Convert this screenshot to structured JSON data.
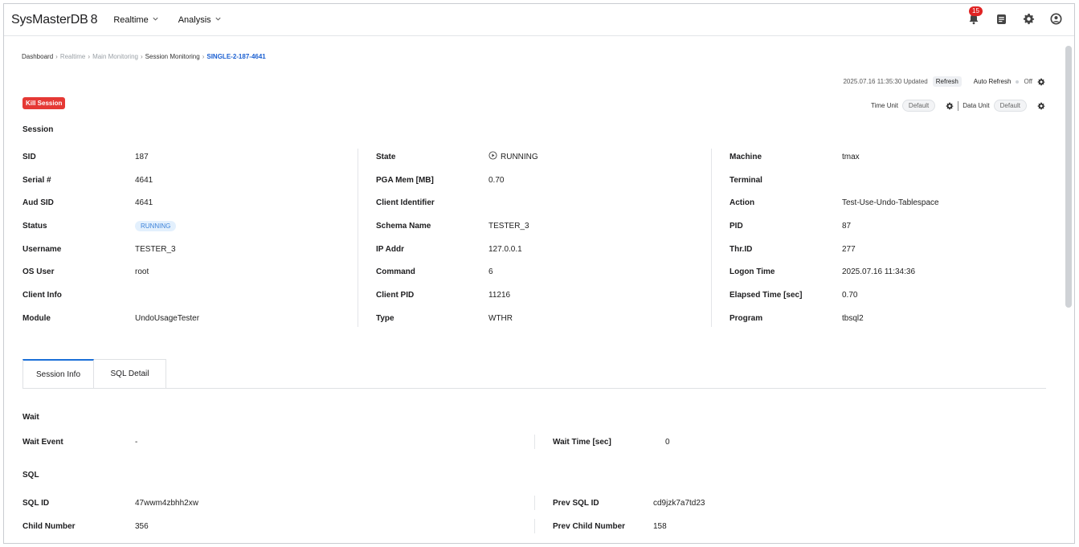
{
  "app": {
    "brand": "SysMasterDB",
    "version": "8"
  },
  "nav": {
    "menu": [
      {
        "label": "Realtime"
      },
      {
        "label": "Analysis"
      }
    ],
    "notification_count": "15",
    "icons": [
      "bell-icon",
      "document-icon",
      "gear-icon",
      "user-circle-icon"
    ]
  },
  "breadcrumb": [
    "Dashboard",
    "Realtime",
    "Main Monitoring",
    "Session Monitoring",
    "SINGLE-2-187-4641"
  ],
  "toolbar": {
    "updated_text": "2025.07.16 11:35:30 Updated",
    "refresh_label": "Refresh",
    "auto_refresh_label": "Auto Refresh",
    "auto_refresh_state": "Off",
    "time_unit_label": "Time Unit",
    "time_unit_value": "Default",
    "data_unit_label": "Data Unit",
    "data_unit_value": "Default"
  },
  "kill_button": "Kill Session",
  "session": {
    "title": "Session",
    "col1": [
      {
        "label": "SID",
        "value": "187"
      },
      {
        "label": "Serial #",
        "value": "4641"
      },
      {
        "label": "Aud SID",
        "value": "4641"
      },
      {
        "label": "Status",
        "value": "RUNNING"
      },
      {
        "label": "Username",
        "value": "TESTER_3"
      },
      {
        "label": "OS User",
        "value": "root"
      },
      {
        "label": "Client Info",
        "value": ""
      },
      {
        "label": "Module",
        "value": "UndoUsageTester"
      }
    ],
    "col2": [
      {
        "label": "State",
        "value": "RUNNING"
      },
      {
        "label": "PGA Mem [MB]",
        "value": "0.70"
      },
      {
        "label": "Client Identifier",
        "value": ""
      },
      {
        "label": "Schema Name",
        "value": "TESTER_3"
      },
      {
        "label": "IP Addr",
        "value": "127.0.0.1"
      },
      {
        "label": "Command",
        "value": "6"
      },
      {
        "label": "Client PID",
        "value": "11216"
      },
      {
        "label": "Type",
        "value": "WTHR"
      }
    ],
    "col3": [
      {
        "label": "Machine",
        "value": "tmax"
      },
      {
        "label": "Terminal",
        "value": ""
      },
      {
        "label": "Action",
        "value": "Test-Use-Undo-Tablespace"
      },
      {
        "label": "PID",
        "value": "87"
      },
      {
        "label": "Thr.ID",
        "value": "277"
      },
      {
        "label": "Logon Time",
        "value": "2025.07.16 11:34:36"
      },
      {
        "label": "Elapsed Time [sec]",
        "value": "0.70"
      },
      {
        "label": "Program",
        "value": "tbsql2"
      }
    ]
  },
  "tabs": [
    {
      "label": "Session Info",
      "active": true
    },
    {
      "label": "SQL Detail",
      "active": false
    }
  ],
  "wait": {
    "title": "Wait",
    "event_label": "Wait Event",
    "event_value": "-",
    "time_label": "Wait Time [sec]",
    "time_value": "0"
  },
  "sql": {
    "title": "SQL",
    "sql_id_label": "SQL ID",
    "sql_id_value": "47wwm4zbhh2xw",
    "prev_sql_id_label": "Prev SQL ID",
    "prev_sql_id_value": "cd9jzk7a7td23",
    "child_label": "Child Number",
    "child_value": "356",
    "prev_child_label": "Prev Child Number",
    "prev_child_value": "158"
  },
  "colors": {
    "accent": "#1a6fd8",
    "danger": "#e53935",
    "status_bg": "#e3f0fd",
    "status_fg": "#3c82d9"
  }
}
